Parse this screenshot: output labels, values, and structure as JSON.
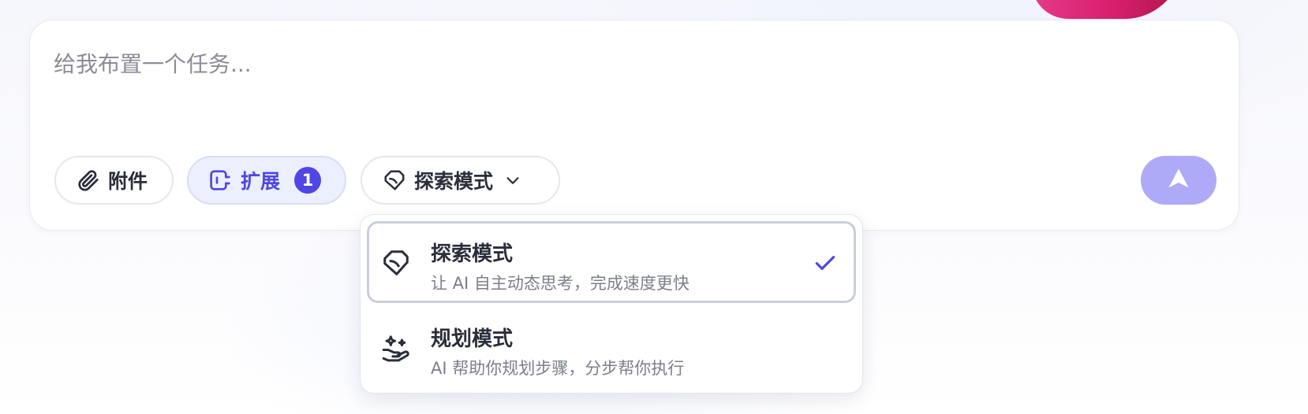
{
  "composer": {
    "placeholder": "给我布置一个任务..."
  },
  "toolbar": {
    "attach_label": "附件",
    "extension_label": "扩展",
    "extension_count": "1",
    "mode_label": "探索模式"
  },
  "mode_menu": {
    "options": [
      {
        "title": "探索模式",
        "description": "让 AI 自主动态思考，完成速度更快",
        "icon": "tag-icon",
        "selected": true
      },
      {
        "title": "规划模式",
        "description": "AI 帮助你规划步骤，分步帮你执行",
        "icon": "sparkle-hand-icon",
        "selected": false
      }
    ]
  },
  "colors": {
    "accent": "#4f46e5",
    "send_button": "#aeaaf7",
    "extension_bg": "#eceffd"
  }
}
